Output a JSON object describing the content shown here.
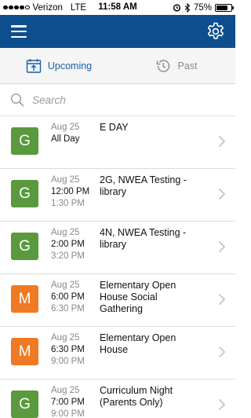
{
  "status_bar": {
    "carrier": "Verizon",
    "network": "LTE",
    "time": "11:58 AM",
    "battery": "75%",
    "battery_level": 0.75
  },
  "nav": {
    "menu_icon": "hamburger-menu-icon",
    "settings_icon": "gear-icon",
    "color": "#0d4e8e"
  },
  "tabs": [
    {
      "label": "Upcoming",
      "icon": "calendar-upload-icon",
      "active": true
    },
    {
      "label": "Past",
      "icon": "history-clock-icon",
      "active": false
    }
  ],
  "search": {
    "placeholder": "Search",
    "value": ""
  },
  "colors": {
    "green": "#5a9a3c",
    "orange": "#f07a24",
    "accent": "#1a5fa8"
  },
  "events": [
    {
      "badge": "G",
      "color": "#5a9a3c",
      "date": "Aug 25",
      "start": "All Day",
      "end": "",
      "title": "E DAY"
    },
    {
      "badge": "G",
      "color": "#5a9a3c",
      "date": "Aug 25",
      "start": "12:00 PM",
      "end": "1:30 PM",
      "title": "2G, NWEA Testing - library"
    },
    {
      "badge": "G",
      "color": "#5a9a3c",
      "date": "Aug 25",
      "start": "2:00 PM",
      "end": "3:20 PM",
      "title": "4N, NWEA Testing - library"
    },
    {
      "badge": "M",
      "color": "#f07a24",
      "date": "Aug 25",
      "start": "6:00 PM",
      "end": "6:30 PM",
      "title": "Elementary Open House Social Gathering"
    },
    {
      "badge": "M",
      "color": "#f07a24",
      "date": "Aug 25",
      "start": "6:30 PM",
      "end": "9:00 PM",
      "title": "Elementary Open House"
    },
    {
      "badge": "G",
      "color": "#5a9a3c",
      "date": "Aug 25",
      "start": "7:00 PM",
      "end": "9:00 PM",
      "title": "Curriculum Night (Parents Only)"
    }
  ]
}
